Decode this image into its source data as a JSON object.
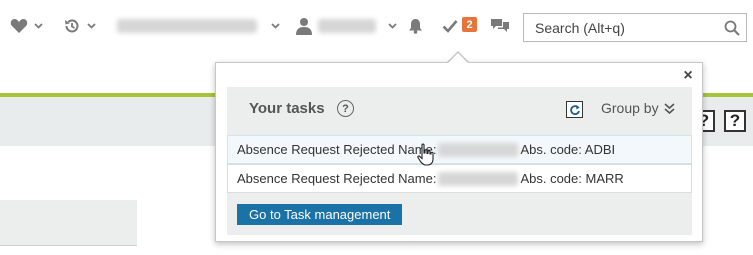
{
  "topbar": {
    "favorites_icon": "heart-icon",
    "history_icon": "history-icon",
    "user_icon": "user-icon",
    "notifications_icon": "bell-icon",
    "tasks_icon": "checkmark-icon",
    "tasks_badge": "2",
    "chat_icon": "chat-icon",
    "search": {
      "placeholder": "Search (Alt+q)"
    }
  },
  "page": {
    "header_buttons": [
      "?",
      "?"
    ]
  },
  "tasks_popup": {
    "title": "Your tasks",
    "help": "?",
    "close": "×",
    "group_by": "Group by",
    "tasks": [
      {
        "label": "Absence Request Rejected Name:",
        "code": "Abs. code: ADBI"
      },
      {
        "label": "Absence Request Rejected Name:",
        "code": "Abs. code: MARR"
      }
    ],
    "goto_button": "Go to Task management"
  },
  "colors": {
    "accent_green": "#a7c43a",
    "button_blue": "#1a72a6",
    "badge_orange": "#e8743b"
  }
}
